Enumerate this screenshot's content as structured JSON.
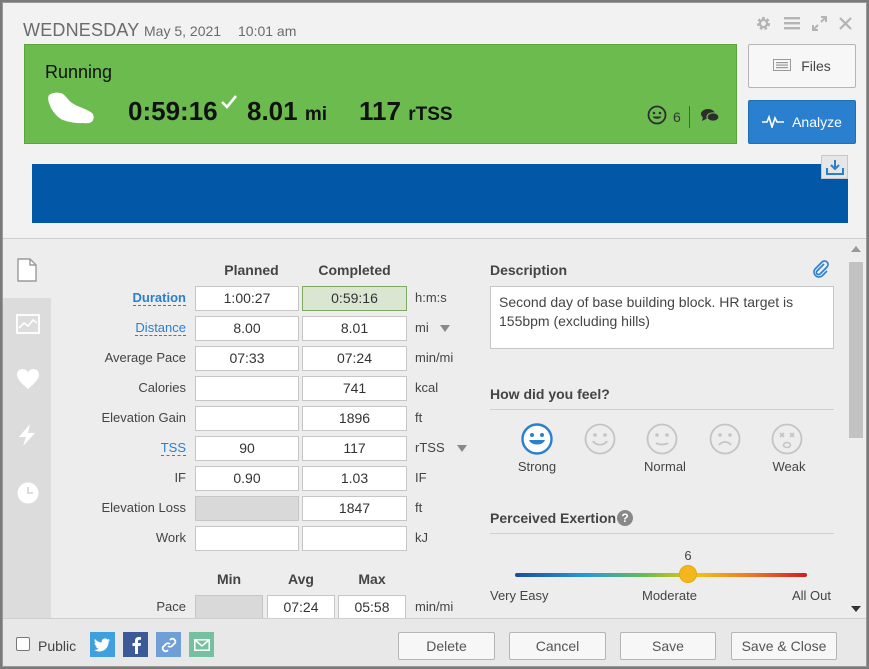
{
  "header": {
    "day": "WEDNESDAY",
    "date": "May 5, 2021",
    "time": "10:01 am"
  },
  "workout": {
    "sport": "Running",
    "duration": "0:59:16",
    "distance_value": "8.01",
    "distance_unit": "mi",
    "tss_value": "117",
    "tss_unit": "rTSS",
    "feel_count": "6"
  },
  "side_buttons": {
    "files": "Files",
    "analyze": "Analyze"
  },
  "table": {
    "col_planned": "Planned",
    "col_completed": "Completed",
    "rows": [
      {
        "label": "Duration",
        "planned": "1:00:27",
        "completed": "0:59:16",
        "unit": "h:m:s"
      },
      {
        "label": "Distance",
        "planned": "8.00",
        "completed": "8.01",
        "unit": "mi"
      },
      {
        "label": "Average Pace",
        "planned": "07:33",
        "completed": "07:24",
        "unit": "min/mi"
      },
      {
        "label": "Calories",
        "planned": "",
        "completed": "741",
        "unit": "kcal"
      },
      {
        "label": "Elevation Gain",
        "planned": "",
        "completed": "1896",
        "unit": "ft"
      },
      {
        "label": "TSS",
        "planned": "90",
        "completed": "117",
        "unit": "rTSS"
      },
      {
        "label": "IF",
        "planned": "0.90",
        "completed": "1.03",
        "unit": "IF"
      },
      {
        "label": "Elevation Loss",
        "planned": "",
        "completed": "1847",
        "unit": "ft"
      },
      {
        "label": "Work",
        "planned": "",
        "completed": "",
        "unit": "kJ"
      }
    ]
  },
  "pace_table": {
    "col_min": "Min",
    "col_avg": "Avg",
    "col_max": "Max",
    "label": "Pace",
    "min": "",
    "avg": "07:24",
    "max": "05:58",
    "unit": "min/mi"
  },
  "description": {
    "title": "Description",
    "text": "Second day of base building block. HR target is 155bpm (excluding hills)"
  },
  "feel": {
    "title": "How did you feel?",
    "labels": {
      "strong": "Strong",
      "normal": "Normal",
      "weak": "Weak"
    },
    "selected": "Strong"
  },
  "exertion": {
    "title": "Perceived Exertion",
    "help": "?",
    "value": "6",
    "min_label": "Very Easy",
    "mid_label": "Moderate",
    "max_label": "All Out"
  },
  "footer": {
    "public_label": "Public",
    "delete": "Delete",
    "cancel": "Cancel",
    "save": "Save",
    "save_close": "Save & Close"
  },
  "colors": {
    "green_panel": "#6cbb4f",
    "blue_bar": "#0257a6",
    "analyze": "#2a7fce"
  }
}
